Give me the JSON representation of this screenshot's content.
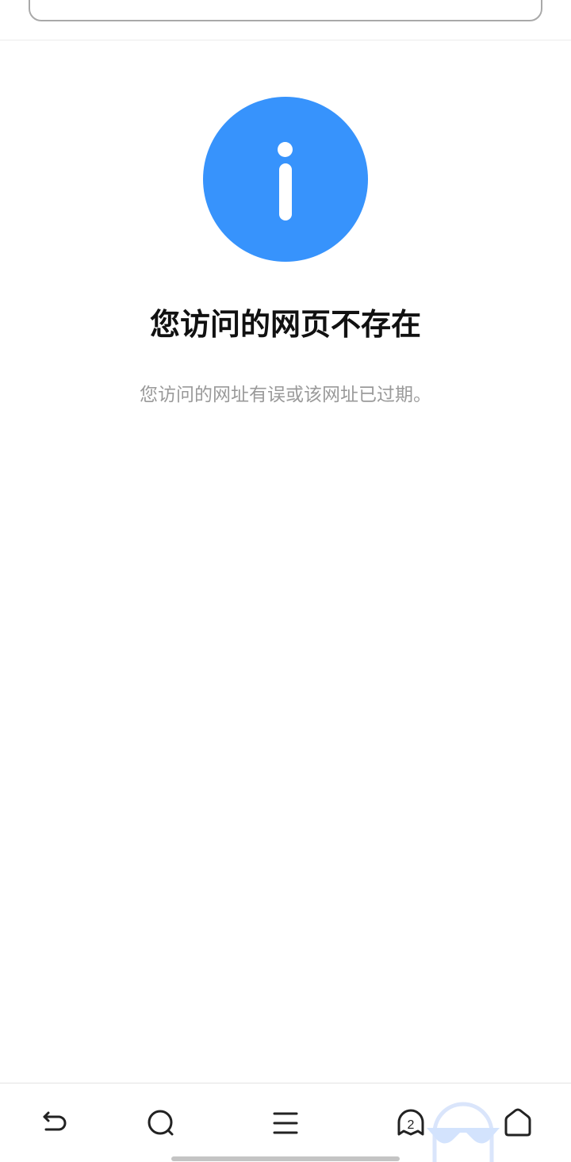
{
  "error": {
    "title": "您访问的网页不存在",
    "message": "您访问的网址有误或该网址已过期。"
  },
  "colors": {
    "accent": "#3793fc",
    "title_text": "#111111",
    "secondary_text": "#9a9a9a"
  },
  "toolbar": {
    "tab_count": "2",
    "icons": [
      "back-icon",
      "search-icon",
      "menu-icon",
      "tabs-icon",
      "home-icon"
    ]
  }
}
